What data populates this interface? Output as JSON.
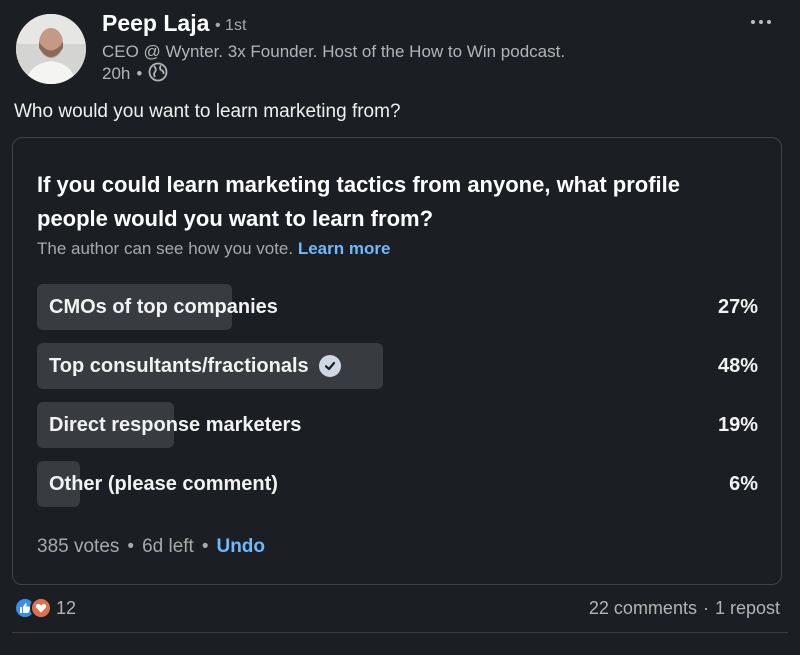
{
  "author": {
    "name": "Peep Laja",
    "degree": "• 1st",
    "headline": "CEO @ Wynter. 3x Founder. Host of the How to Win podcast.",
    "time": "20h",
    "separator": "•",
    "visibility_icon": "globe-icon"
  },
  "post": {
    "text": "Who would you want to learn marketing from?"
  },
  "poll": {
    "question": "If you could learn marketing tactics from anyone, what profile people would you want to learn from?",
    "note": "The author can see how you vote.",
    "learn_more": "Learn more",
    "options": [
      {
        "label": "CMOs of top companies",
        "percent_text": "27%",
        "percent": 27,
        "selected": false
      },
      {
        "label": "Top consultants/fractionals",
        "percent_text": "48%",
        "percent": 48,
        "selected": true
      },
      {
        "label": "Direct response marketers",
        "percent_text": "19%",
        "percent": 19,
        "selected": false
      },
      {
        "label": "Other (please comment)",
        "percent_text": "6%",
        "percent": 6,
        "selected": false
      }
    ],
    "votes": "385 votes",
    "dot": "•",
    "time_left": "6d left",
    "undo": "Undo"
  },
  "social": {
    "reaction_icons": [
      "like-icon",
      "love-icon"
    ],
    "reaction_count": "12",
    "comments": "22 comments",
    "dot": "·",
    "reposts": "1 repost"
  },
  "colors": {
    "background": "#1b1f23",
    "link": "#71b7fb",
    "bar": "#383c40",
    "border": "#3f4448"
  }
}
